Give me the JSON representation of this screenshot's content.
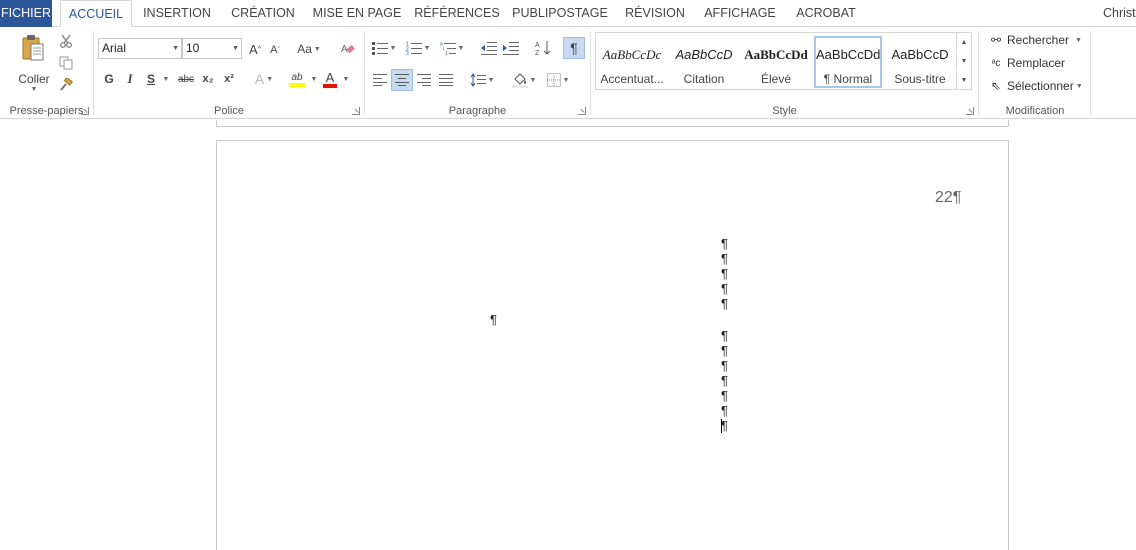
{
  "tabs": [
    {
      "label": "FICHIER"
    },
    {
      "label": "ACCUEIL"
    },
    {
      "label": "INSERTION"
    },
    {
      "label": "CRÉATION"
    },
    {
      "label": "MISE EN PAGE"
    },
    {
      "label": "RÉFÉRENCES"
    },
    {
      "label": "PUBLIPOSTAGE"
    },
    {
      "label": "RÉVISION"
    },
    {
      "label": "AFFICHAGE"
    },
    {
      "label": "ACROBAT"
    }
  ],
  "user_name": "Christ",
  "groups": {
    "clipboard": "Presse-papiers",
    "font": "Police",
    "paragraph": "Paragraphe",
    "styles": "Style",
    "editing": "Modification"
  },
  "clipboard": {
    "paste_label": "Coller"
  },
  "font": {
    "family": "Arial",
    "size": "10",
    "grow": "A",
    "shrink": "A",
    "case": "Aa",
    "bold": "G",
    "italic": "I",
    "underline": "S",
    "strike": "abc",
    "subscript": "x₂",
    "superscript": "x²",
    "effects": "A",
    "highlight": "ab",
    "color": "A"
  },
  "styles": [
    {
      "sample": "AaBbCcDc",
      "name": "Accentuat..."
    },
    {
      "sample": "AaBbCcD",
      "name": "Citation"
    },
    {
      "sample": "AaBbCcDd",
      "name": "Élevé"
    },
    {
      "sample": "AaBbCcDd",
      "name": "¶ Normal"
    },
    {
      "sample": "AaBbCcD",
      "name": "Sous-titre"
    }
  ],
  "editing": {
    "find": "Rechercher",
    "replace": "Remplacer",
    "select": "Sélectionner"
  },
  "document": {
    "page_number": "22¶",
    "pilcrow": "¶"
  },
  "colors": {
    "file_tab": "#2b579a",
    "active_tab_text": "#2b579a",
    "highlight": "#ffff00",
    "font_color": "#e51400",
    "selected_button": "#c5d9f1"
  }
}
